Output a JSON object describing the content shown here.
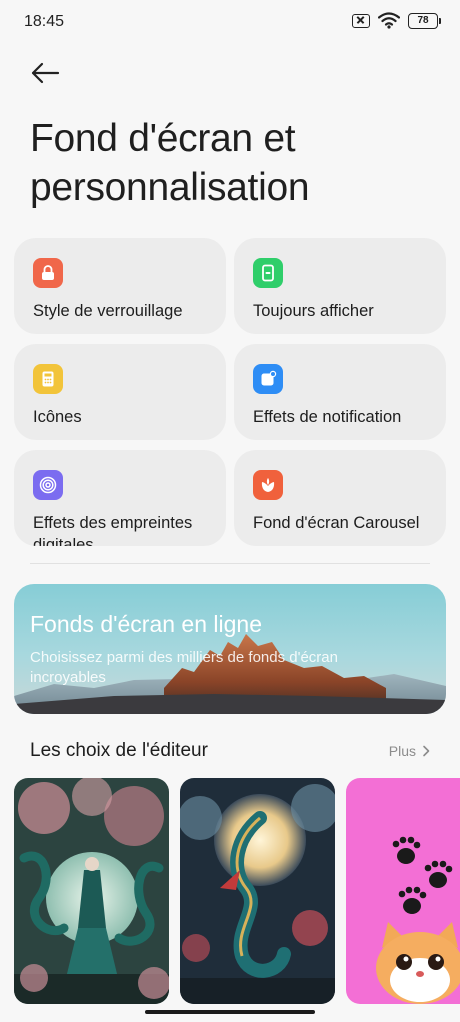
{
  "status_bar": {
    "time": "18:45",
    "battery": "78",
    "icons": [
      "sim-off-icon",
      "wifi-icon",
      "battery-icon"
    ]
  },
  "header": {
    "back_icon": "arrow-left-icon",
    "title": "Fond d'écran et personnalisation"
  },
  "tiles": [
    {
      "label": "Style de verrouillage",
      "icon": "lock-icon",
      "color": "#f0674a"
    },
    {
      "label": "Toujours afficher",
      "icon": "phone-display-icon",
      "color": "#2fce6a"
    },
    {
      "label": "Icônes",
      "icon": "calculator-icon",
      "color": "#f2c43a"
    },
    {
      "label": "Effets de notification",
      "icon": "notification-icon",
      "color": "#2e8df5"
    },
    {
      "label": "Effets des empreintes digitales",
      "icon": "fingerprint-icon",
      "color": "#7b6cf0"
    },
    {
      "label": "Fond d'écran Carousel",
      "icon": "flower-icon",
      "color": "#f0613c"
    }
  ],
  "banner": {
    "title": "Fonds d'écran en ligne",
    "subtitle": "Choisissez parmi des milliers de fonds d'écran incroyables"
  },
  "editors_choice": {
    "title": "Les choix de l'éditeur",
    "more_label": "Plus",
    "cards": [
      "dragon-warrior-wallpaper",
      "dragon-moon-wallpaper",
      "cat-paws-wallpaper"
    ]
  },
  "colors": {
    "background": "#f7f7f7",
    "tile_bg": "#ececec",
    "cat_card_bg": "#f36fd5"
  }
}
